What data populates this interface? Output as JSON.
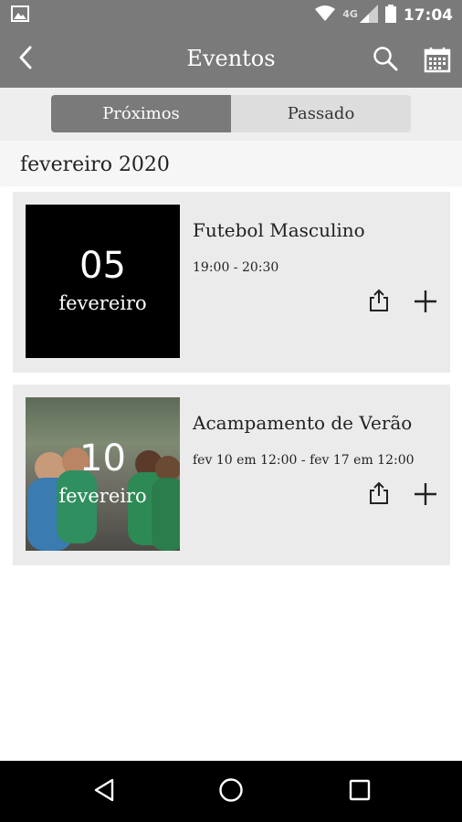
{
  "status_bar": {
    "time": "17:04",
    "network": "4G"
  },
  "app_bar": {
    "title": "Eventos"
  },
  "tabs": [
    {
      "label": "Próximos",
      "active": true
    },
    {
      "label": "Passado",
      "active": false
    }
  ],
  "month_header": "fevereiro 2020",
  "events": [
    {
      "day": "05",
      "month": "fevereiro",
      "title": "Futebol Masculino",
      "time": "19:00 - 20:30",
      "has_image": false
    },
    {
      "day": "10",
      "month": "fevereiro",
      "title": "Acampamento de Verão",
      "time": "fev 10 em 12:00 - fev 17 em 12:00",
      "has_image": true
    }
  ],
  "colors": {
    "accent": "#7a7a7a",
    "card_bg": "#ebebeb",
    "tab_inactive": "#dddddd",
    "nav_bar": "#000000"
  }
}
